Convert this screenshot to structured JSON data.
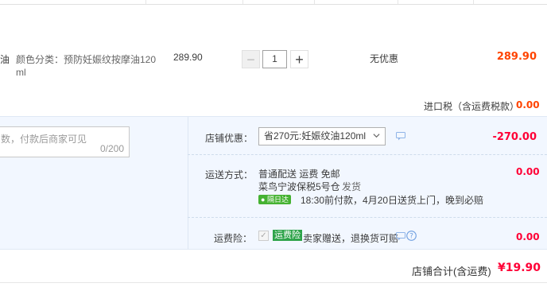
{
  "product": {
    "name_fragment": "油",
    "sku_label": "颜色分类：预防妊娠纹按摩油120",
    "sku_label_cont": "ml",
    "unit_price": "289.90",
    "quantity": "1",
    "discount": "无优惠",
    "subtotal": "289.90",
    "minus_symbol": "−",
    "plus_symbol": "+"
  },
  "tax": {
    "label": "进口税（含运费税款）",
    "value": "0.00"
  },
  "memo": {
    "placeholder": "数，付款后商家可见",
    "counter": "0/200"
  },
  "shop_discount": {
    "label": "店铺优惠：",
    "selected": "省270元:妊娠纹油120ml",
    "value": "-270.00"
  },
  "shipping": {
    "label": "运送方式：",
    "line1": "普通配送 运费 免邮",
    "line2_a": "菜鸟宁波保税5号仓",
    "line2_b": "发货",
    "ontime_badge": "隔日达",
    "line3": "18:30前付款，4月20日送货上门，晚到必赔",
    "value": "0.00"
  },
  "insurance": {
    "label": "运费险：",
    "badge": "运费险",
    "text": "卖家赠送，退换货可赔",
    "value": "0.00"
  },
  "total": {
    "label": "店铺合计(含运费)",
    "value": "¥19.90"
  },
  "colors": {
    "accent": "#ff4400",
    "light_blue_bg": "#f2f7ff",
    "border_blue": "#b2d1ff",
    "green": "#2ea34a"
  }
}
